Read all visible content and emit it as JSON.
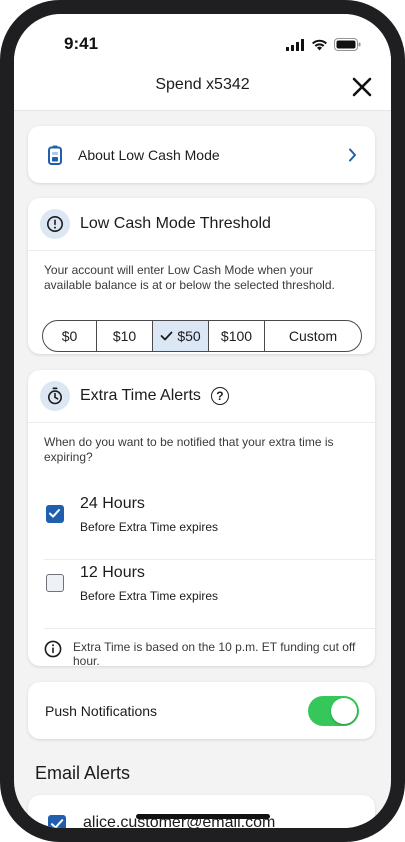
{
  "status": {
    "time": "9:41",
    "icons": [
      "signal-icon",
      "wifi-icon",
      "battery-icon"
    ]
  },
  "nav": {
    "title": "Spend x5342",
    "close_icon": "close-icon"
  },
  "about": {
    "label": "About Low Cash Mode",
    "icon": "battery-low-icon",
    "chevron": "chevron-right-icon"
  },
  "threshold": {
    "title": "Low Cash Mode Threshold",
    "icon": "alert-circle-icon",
    "description": "Your account will enter Low Cash Mode when your available balance is at or below the selected threshold.",
    "options": [
      {
        "label": "$0",
        "selected": false
      },
      {
        "label": "$10",
        "selected": false
      },
      {
        "label": "$50",
        "selected": true
      },
      {
        "label": "$100",
        "selected": false
      },
      {
        "label": "Custom",
        "selected": false
      }
    ]
  },
  "extra_time": {
    "title": "Extra Time Alerts",
    "icon": "stopwatch-icon",
    "help_icon": "question-circle-icon",
    "help_glyph": "?",
    "description": "When do you want to be notified that your extra time is expiring?",
    "options": [
      {
        "title": "24 Hours",
        "subtitle": "Before Extra Time expires",
        "checked": true
      },
      {
        "title": "12 Hours",
        "subtitle": "Before Extra Time expires",
        "checked": false
      }
    ],
    "note": "Extra Time is based on the 10 p.m. ET funding cut off hour."
  },
  "push": {
    "label": "Push Notifications",
    "enabled": true
  },
  "email": {
    "heading": "Email Alerts",
    "address": "alice.customer@email.com",
    "checked": true
  },
  "colors": {
    "accent_blue": "#1f5fad",
    "toggle_green": "#35c759",
    "selected_segment": "#dbe7f5",
    "background": "#f3f3f4"
  }
}
